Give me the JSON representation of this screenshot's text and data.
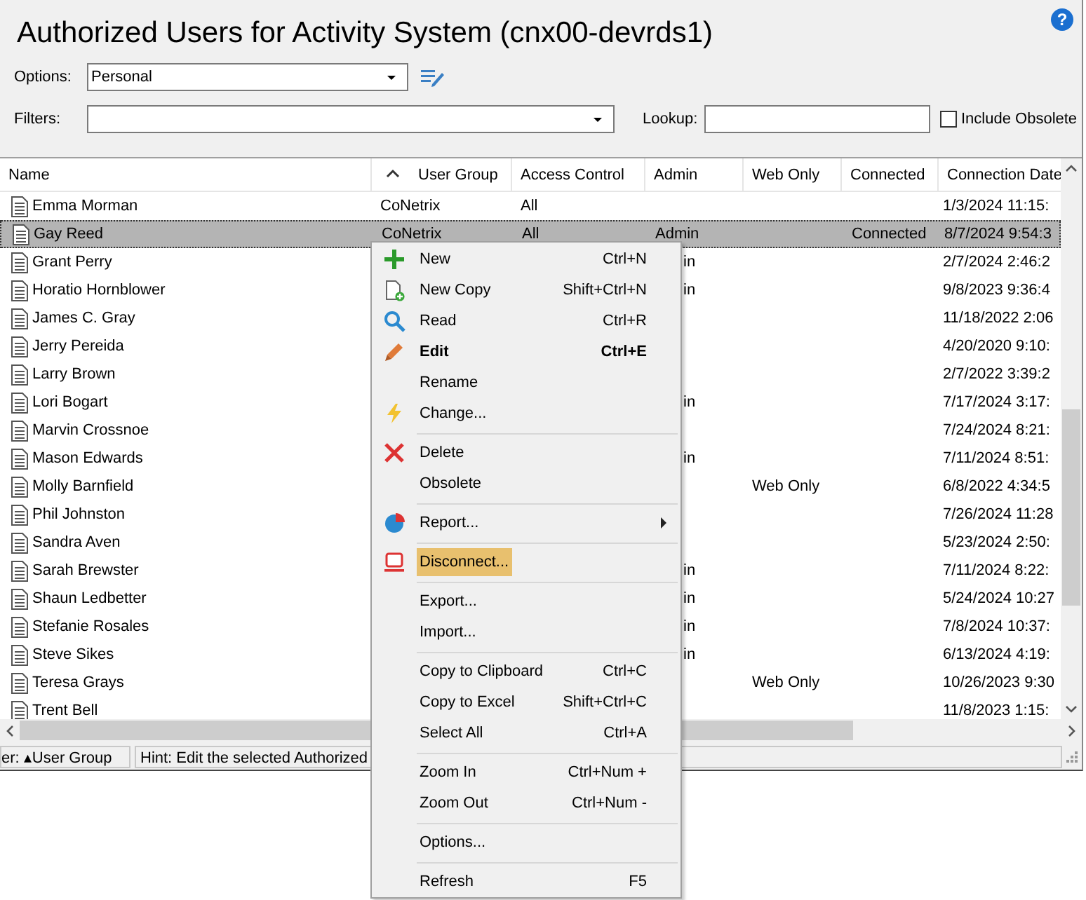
{
  "window": {
    "title": "Authorized Users for Activity System (cnx00-devrds1)",
    "help": "?"
  },
  "options": {
    "label": "Options:",
    "value": "Personal"
  },
  "filters": {
    "label": "Filters:"
  },
  "lookup": {
    "label": "Lookup:"
  },
  "include_obsolete": {
    "label": "Include Obsolete",
    "checked": false
  },
  "table": {
    "columns": [
      {
        "label": "Name",
        "sorted": false
      },
      {
        "label": "User Group",
        "sorted": true
      },
      {
        "label": "Access Control",
        "sorted": false
      },
      {
        "label": "Admin",
        "sorted": false
      },
      {
        "label": "Web Only",
        "sorted": false
      },
      {
        "label": "Connected",
        "sorted": false
      },
      {
        "label": "Connection Date",
        "sorted": false
      }
    ],
    "rows": [
      {
        "selected": false,
        "cells": [
          "Emma Morman",
          "CoNetrix",
          "All",
          "",
          "",
          "",
          "1/3/2024 11:15:"
        ]
      },
      {
        "selected": true,
        "cells": [
          "Gay Reed",
          "CoNetrix",
          "All",
          "Admin",
          "",
          "Connected",
          "8/7/2024 9:54:3"
        ]
      },
      {
        "selected": false,
        "cut": true,
        "cells": [
          "Grant Perry",
          "",
          "",
          "in",
          "",
          "",
          "2/7/2024 2:46:2"
        ]
      },
      {
        "selected": false,
        "cut": true,
        "cells": [
          "Horatio Hornblower",
          "",
          "",
          "in",
          "",
          "",
          "9/8/2023 9:36:4"
        ]
      },
      {
        "selected": false,
        "cells": [
          "James C. Gray",
          "",
          "",
          "",
          "",
          "",
          "11/18/2022 2:06"
        ]
      },
      {
        "selected": false,
        "cells": [
          "Jerry Pereida",
          "",
          "",
          "",
          "",
          "",
          "4/20/2020 9:10:"
        ]
      },
      {
        "selected": false,
        "cells": [
          "Larry Brown",
          "",
          "",
          "",
          "",
          "",
          "2/7/2022 3:39:2"
        ]
      },
      {
        "selected": false,
        "cut": true,
        "cells": [
          "Lori Bogart",
          "",
          "",
          "in",
          "",
          "",
          "7/17/2024 3:17:"
        ]
      },
      {
        "selected": false,
        "cells": [
          "Marvin Crossnoe",
          "",
          "",
          "",
          "",
          "",
          "7/24/2024 8:21:"
        ]
      },
      {
        "selected": false,
        "cut": true,
        "cells": [
          "Mason Edwards",
          "",
          "",
          "in",
          "",
          "",
          "7/11/2024 8:51:"
        ]
      },
      {
        "selected": false,
        "cells": [
          "Molly Barnfield",
          "",
          "",
          "",
          "Web Only",
          "",
          "6/8/2022 4:34:5"
        ]
      },
      {
        "selected": false,
        "cells": [
          "Phil Johnston",
          "",
          "",
          "",
          "",
          "",
          "7/26/2024 11:28"
        ]
      },
      {
        "selected": false,
        "cells": [
          "Sandra Aven",
          "",
          "",
          "",
          "",
          "",
          "5/23/2024 2:50:"
        ]
      },
      {
        "selected": false,
        "cut": true,
        "cells": [
          "Sarah Brewster",
          "",
          "",
          "in",
          "",
          "",
          "7/11/2024 8:22:"
        ]
      },
      {
        "selected": false,
        "cut": true,
        "cells": [
          "Shaun Ledbetter",
          "",
          "",
          "in",
          "",
          "",
          "5/24/2024 10:27"
        ]
      },
      {
        "selected": false,
        "cut": true,
        "cells": [
          "Stefanie Rosales",
          "",
          "",
          "in",
          "",
          "",
          "7/8/2024 10:37:"
        ]
      },
      {
        "selected": false,
        "cut": true,
        "cells": [
          "Steve Sikes",
          "",
          "",
          "in",
          "",
          "",
          "6/13/2024 4:19:"
        ]
      },
      {
        "selected": false,
        "cells": [
          "Teresa Grays",
          "",
          "",
          "",
          "Web Only",
          "",
          "10/26/2023 9:30"
        ]
      },
      {
        "selected": false,
        "cells": [
          "Trent Bell",
          "",
          "",
          "",
          "",
          "",
          "11/8/2023 1:15:"
        ]
      }
    ]
  },
  "status_bar": {
    "sort": "er: ▴User Group",
    "hint": "Hint:  Edit the selected Authorized"
  },
  "context_menu": {
    "groups": [
      [
        {
          "label": "New",
          "shortcut": "Ctrl+N",
          "kind": "add",
          "selected": false
        },
        {
          "label": "New Copy",
          "shortcut": "Shift+Ctrl+N",
          "kind": "copy",
          "selected": false
        },
        {
          "label": "Read",
          "shortcut": "Ctrl+R",
          "kind": "read",
          "selected": false
        },
        {
          "label": "Edit",
          "shortcut": "Ctrl+E",
          "kind": "edit",
          "default": true,
          "selected": false
        },
        {
          "label": "Rename",
          "selected": false
        },
        {
          "label": "Change...",
          "kind": "change",
          "selected": false
        }
      ],
      [
        {
          "label": "Delete",
          "kind": "delete",
          "selected": false
        },
        {
          "label": "Obsolete",
          "selected": false
        }
      ],
      [
        {
          "label": "Report...",
          "kind": "report",
          "submenu": true,
          "selected": false
        }
      ],
      [
        {
          "label": "Disconnect...",
          "kind": "disconnect",
          "selected": true
        }
      ],
      [
        {
          "label": "Export...",
          "selected": false
        },
        {
          "label": "Import...",
          "selected": false
        }
      ],
      [
        {
          "label": "Copy to Clipboard",
          "shortcut": "Ctrl+C",
          "selected": false
        },
        {
          "label": "Copy to Excel",
          "shortcut": "Shift+Ctrl+C",
          "selected": false
        },
        {
          "label": "Select All",
          "shortcut": "Ctrl+A",
          "selected": false
        }
      ],
      [
        {
          "label": "Zoom In",
          "shortcut": "Ctrl+Num +",
          "selected": false
        },
        {
          "label": "Zoom Out",
          "shortcut": "Ctrl+Num -",
          "selected": false
        }
      ],
      [
        {
          "label": "Options...",
          "selected": false
        }
      ],
      [
        {
          "label": "Refresh",
          "shortcut": "F5",
          "selected": false
        }
      ]
    ]
  }
}
